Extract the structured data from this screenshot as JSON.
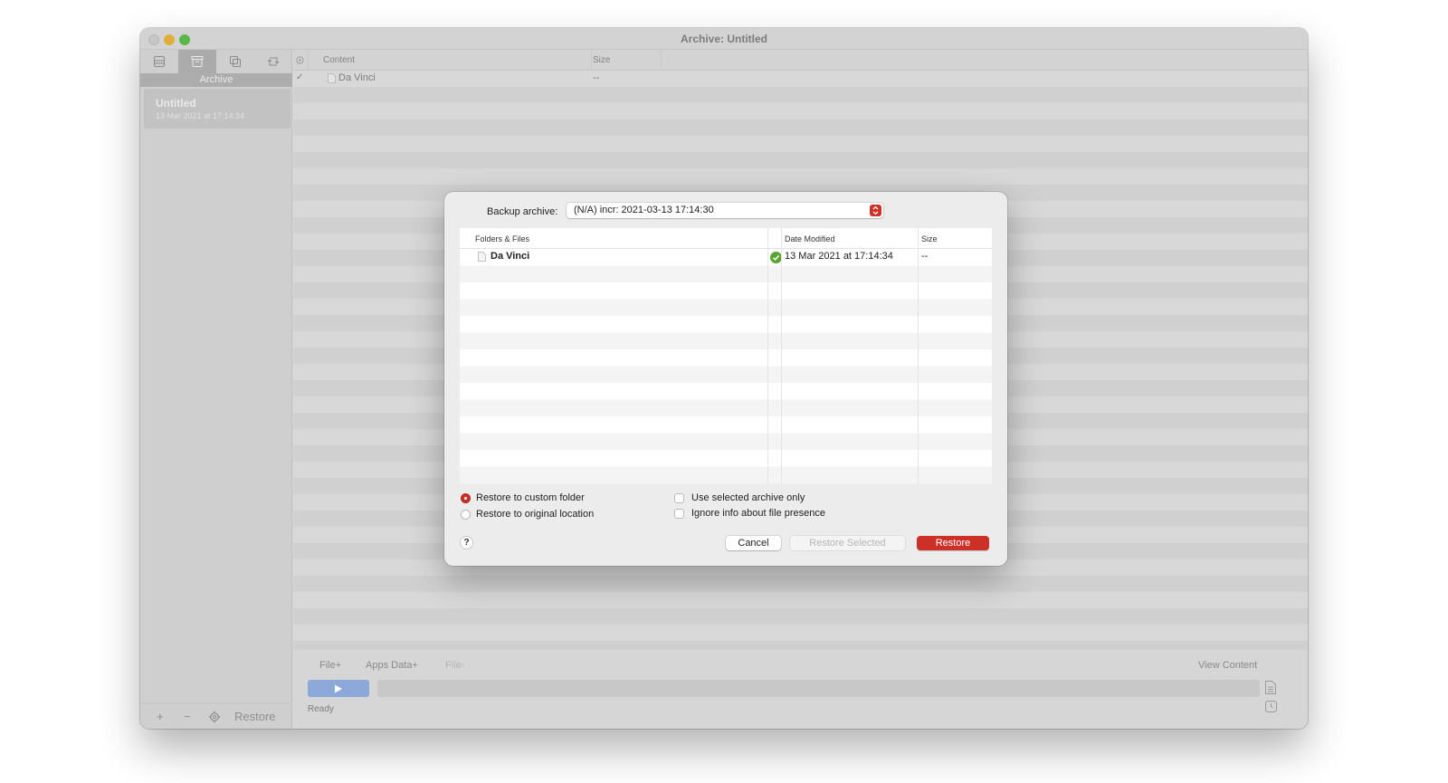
{
  "window": {
    "title": "Archive: Untitled"
  },
  "sidebar": {
    "section_label": "Archive",
    "tabs": [
      {
        "icon": "tray-stack-icon"
      },
      {
        "icon": "archive-box-icon"
      },
      {
        "icon": "duplicate-icon"
      },
      {
        "icon": "sync-arrows-icon"
      }
    ],
    "item": {
      "title": "Untitled",
      "subtitle": "13 Mar 2021 at 17:14:34"
    },
    "bottom": {
      "add_label": "+",
      "remove_label": "−",
      "restore_label": "Restore"
    }
  },
  "content_table": {
    "columns": [
      "Content",
      "Size"
    ],
    "rows": [
      {
        "checked": true,
        "check_mark": "✓",
        "name": "Da Vinci",
        "size": "--"
      }
    ]
  },
  "footer": {
    "tabs": [
      "File+",
      "Apps Data+",
      "File-"
    ],
    "view_content_label": "View Content",
    "status": "Ready"
  },
  "dialog": {
    "backup_label": "Backup archive:",
    "backup_value": "(N/A) incr: 2021-03-13 17:14:30",
    "table": {
      "columns": [
        "Folders & Files",
        "Date Modified",
        "Size"
      ],
      "rows": [
        {
          "name": "Da Vinci",
          "date": "13 Mar 2021 at 17:14:34",
          "size": "--"
        }
      ]
    },
    "options": {
      "restore_custom": "Restore to custom folder",
      "restore_original": "Restore to original location",
      "use_selected": "Use selected archive only",
      "ignore_info": "Ignore info about file presence",
      "selected_restore_target": "custom"
    },
    "buttons": {
      "help": "?",
      "cancel": "Cancel",
      "restore_selected": "Restore Selected",
      "restore": "Restore"
    }
  },
  "colors": {
    "accent_red": "#cc3027",
    "success_green": "#5aa532",
    "play_blue": "#8ba8d8"
  }
}
